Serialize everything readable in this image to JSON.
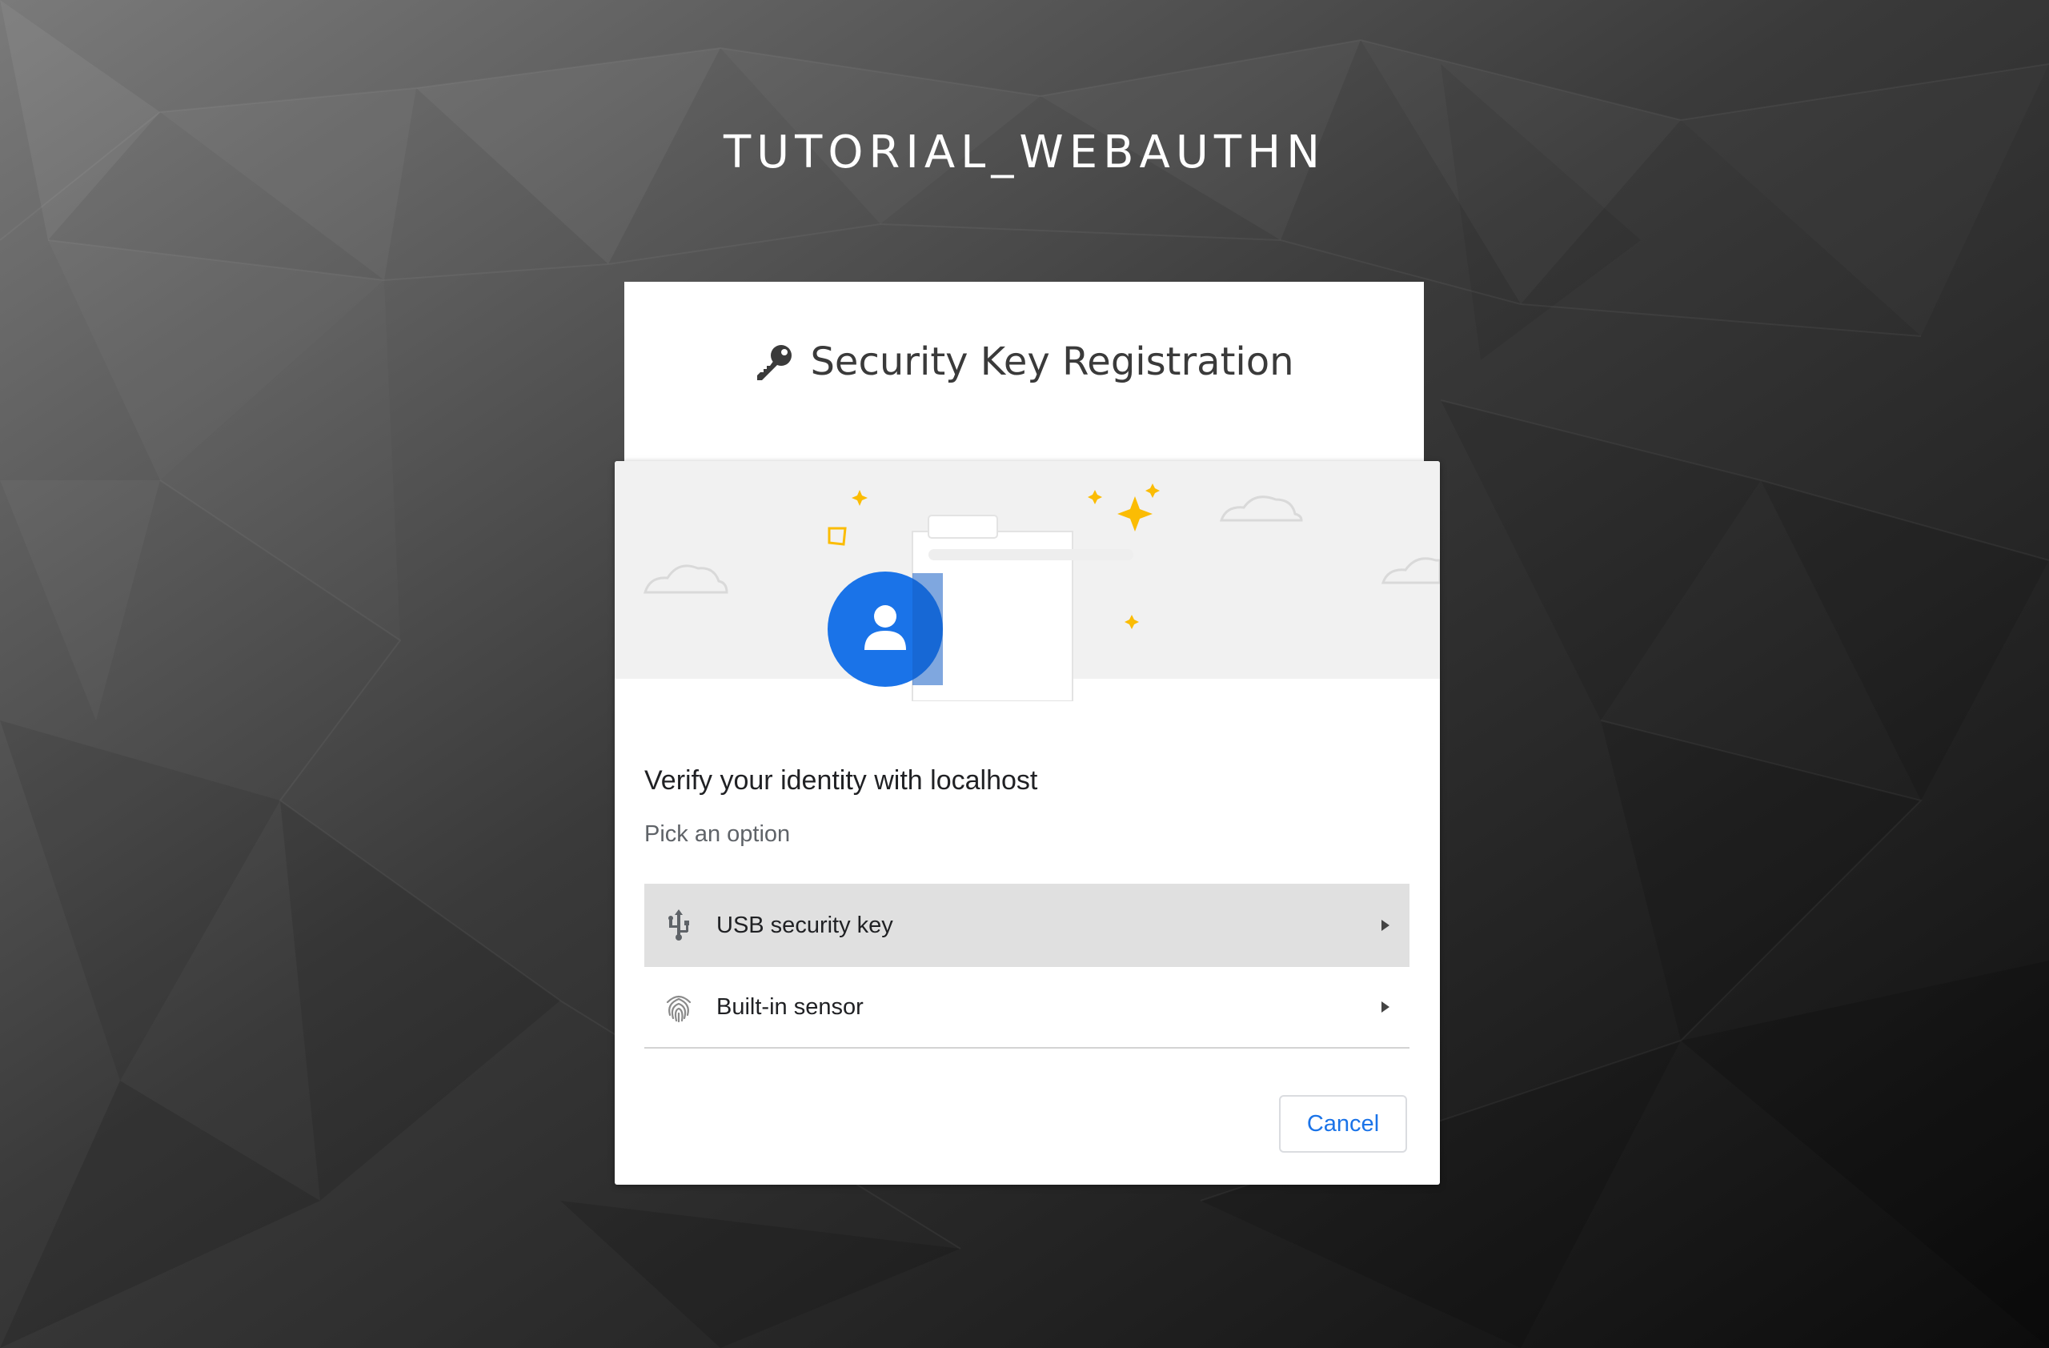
{
  "app": {
    "title": "TUTORIAL_WEBAUTHN"
  },
  "card": {
    "title": "Security Key Registration",
    "icon": "key-icon"
  },
  "dialog": {
    "heading": "Verify your identity with localhost",
    "subheading": "Pick an option",
    "options": [
      {
        "label": "USB security key",
        "icon": "usb-icon",
        "selected": true
      },
      {
        "label": "Built-in sensor",
        "icon": "fingerprint-icon",
        "selected": false
      }
    ],
    "cancel_label": "Cancel"
  },
  "colors": {
    "accent": "#1a73e8",
    "avatar": "#1a73e8",
    "sparkle": "#fbbc04",
    "illustration_bg": "#f1f1f1",
    "selected_row": "#e0e0e0"
  }
}
